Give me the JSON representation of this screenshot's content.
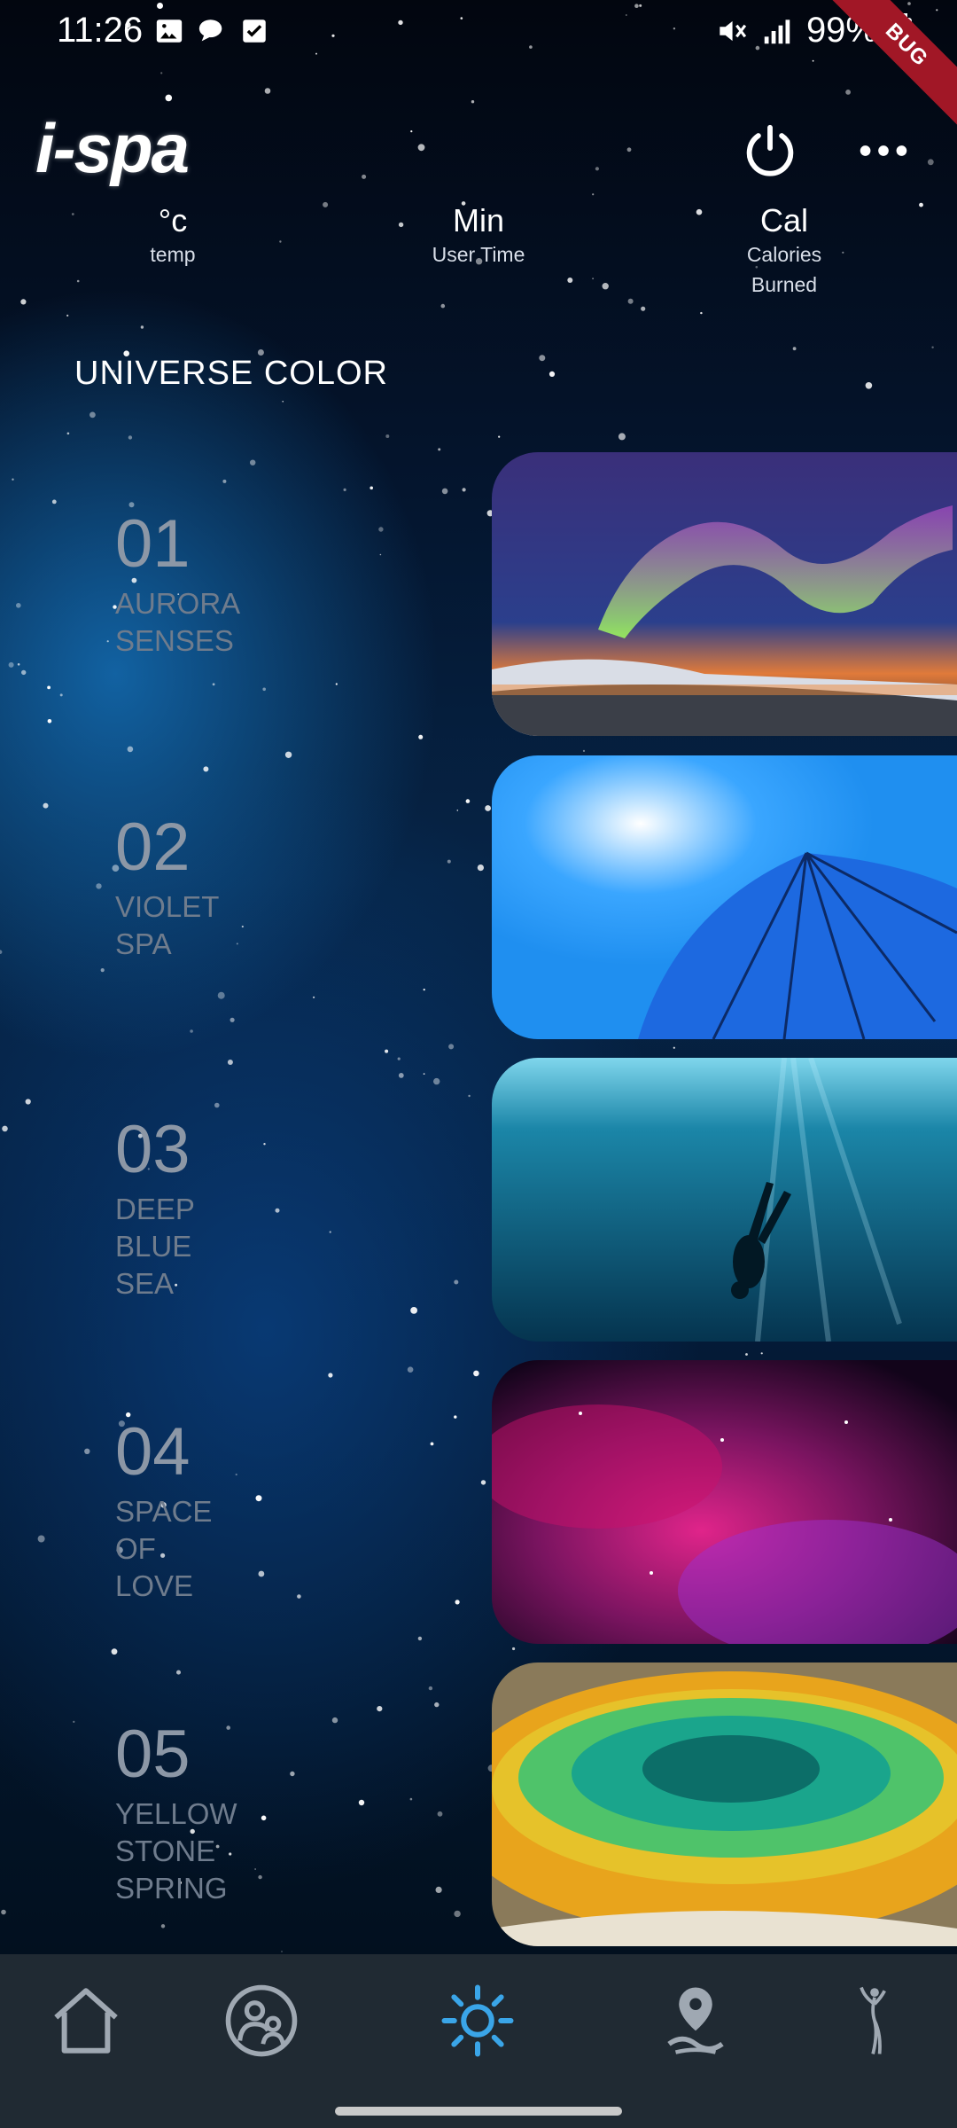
{
  "status_bar": {
    "time": "11:26",
    "battery": "99%",
    "debug_banner": "BUG",
    "left_icons": [
      "image-icon",
      "chat-bubble-icon",
      "checkbox-icon"
    ],
    "right_icons": [
      "mute-icon",
      "signal-icon",
      "battery-icon"
    ]
  },
  "header": {
    "logo_text": "i-spa",
    "power_icon": "power-icon",
    "more_icon": "more-horizontal-icon"
  },
  "stats": [
    {
      "value": "°c",
      "label": "temp"
    },
    {
      "value": "Min",
      "label": "User Time"
    },
    {
      "value": "Cal",
      "label_line1": "Calories",
      "label_line2": "Burned"
    }
  ],
  "section_title": "UNIVERSE COLOR",
  "themes": [
    {
      "number": "01",
      "name_lines": [
        "AURORA",
        "SENSES"
      ],
      "image": "aurora-image"
    },
    {
      "number": "02",
      "name_lines": [
        "VIOLET",
        "SPA"
      ],
      "image": "umbrella-sky-image"
    },
    {
      "number": "03",
      "name_lines": [
        "DEEP",
        "BLUE",
        "SEA"
      ],
      "image": "underwater-diver-image"
    },
    {
      "number": "04",
      "name_lines": [
        "SPACE",
        "OF",
        "LOVE"
      ],
      "image": "pink-nebula-image"
    },
    {
      "number": "05",
      "name_lines": [
        "YELLOW",
        "STONE",
        "SPRING"
      ],
      "image": "hot-spring-image"
    }
  ],
  "bottom_nav": {
    "items": [
      "home-icon",
      "users-icon",
      "sun-icon",
      "location-pin-icon",
      "figure-icon"
    ],
    "active": "sun-icon",
    "active_color": "#3aa5e8",
    "inactive_color": "#9fa8b2"
  }
}
